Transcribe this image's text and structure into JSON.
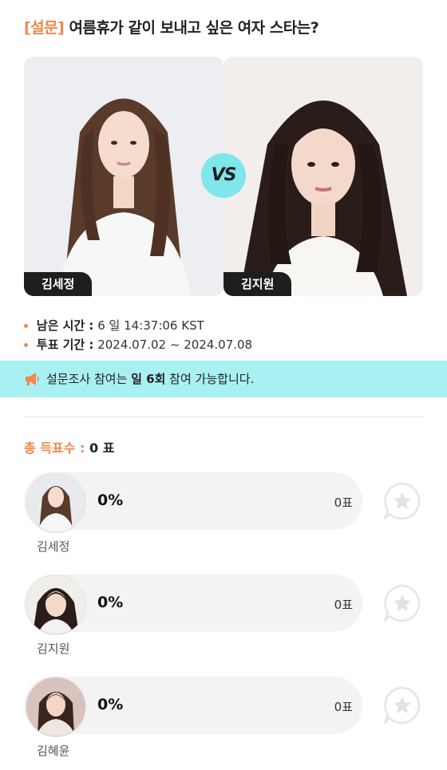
{
  "survey": {
    "tag": "[설문]",
    "question": "여름휴가 같이 보내고 싶은 여자 스타는?"
  },
  "matchup": {
    "left_name": "김세정",
    "right_name": "김지원",
    "vs_label": "VS"
  },
  "info": {
    "remaining_label": "남은 시간 :",
    "remaining_value": "6 일 14:37:06 KST",
    "period_label": "투표 기간 :",
    "period_value": "2024.07.02 ~ 2024.07.08"
  },
  "notice": {
    "prefix": "설문조사 참여는 ",
    "bold": "일 6회",
    "suffix": " 참여 가능합니다."
  },
  "total": {
    "label": "총 득표수 :",
    "value": "0 표"
  },
  "candidates": [
    {
      "name": "김세정",
      "percent": "0%",
      "votes": "0표"
    },
    {
      "name": "김지원",
      "percent": "0%",
      "votes": "0표"
    },
    {
      "name": "김혜윤",
      "percent": "0%",
      "votes": "0표"
    }
  ],
  "colors": {
    "accent": "#f0884a",
    "notice_bg": "#a9f0f2",
    "vs_bg": "#7fe6ea"
  }
}
